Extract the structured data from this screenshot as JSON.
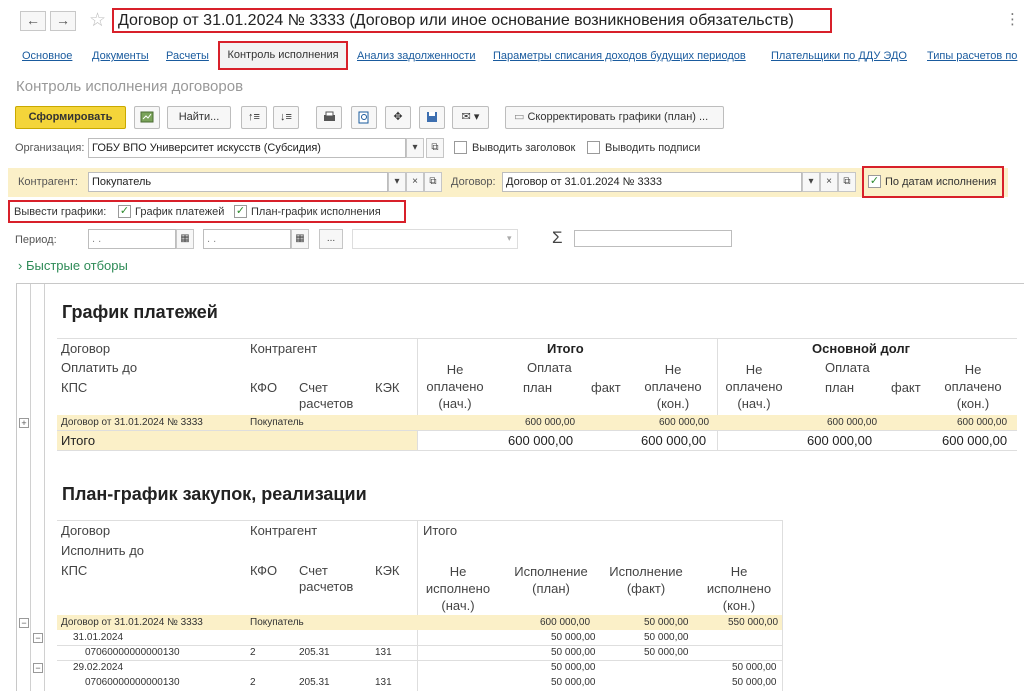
{
  "window": {
    "title": "Договор от 31.01.2024 № 3333 (Договор или иное основание возникновения обязательств)",
    "back_label": "←",
    "forward_label": "→",
    "more_label": "⋮"
  },
  "tabs": [
    "Основное",
    "Документы",
    "Расчеты",
    "Контроль исполнения",
    "Анализ задолженности",
    "Параметры списания доходов будущих периодов",
    "Плательщики по ДДУ ЭДО",
    "Типы расчетов по"
  ],
  "subtitle": "Контроль исполнения договоров",
  "toolbar": {
    "generate": "Сформировать",
    "find": "Найти...",
    "adjust": "Скорректировать графики (план) ..."
  },
  "filters": {
    "org_label": "Организация:",
    "org_value": "ГОБУ ВПО Университет искусств (Субсидия)",
    "show_header": "Выводить заголовок",
    "show_signatures": "Выводить подписи",
    "counterparty_label": "Контрагент:",
    "counterparty_value": "Покупатель",
    "contract_label": "Договор:",
    "contract_value": "Договор от 31.01.2024 № 3333",
    "by_dates": "По датам исполнения",
    "graphs_label": "Вывести графики:",
    "payments_graph": "График платежей",
    "plan_graph": "План-график исполнения",
    "period_label": "Период:",
    "date_placeholder": " .  .",
    "quick_filters": "Быстрые отборы"
  },
  "payments": {
    "title": "График платежей",
    "hdr": {
      "contract": "Договор",
      "pay_until": "Оплатить до",
      "kps": "КПС",
      "counterparty": "Контрагент",
      "kfo": "КФО",
      "account": "Счет расчетов",
      "kek": "КЭК",
      "total": "Итого",
      "principal": "Основной долг",
      "unpaid_start": "Не оплачено (нач.)",
      "payment": "Оплата",
      "plan": "план",
      "fact": "факт",
      "unpaid_end": "Не оплачено (кон.)"
    },
    "row": {
      "contract": "Договор от 31.01.2024 № 3333",
      "counterparty": "Покупатель",
      "plan": "600 000,00",
      "unpaid_end": "600 000,00",
      "plan2": "600 000,00",
      "unpaid_end2": "600 000,00"
    },
    "total": {
      "label": "Итого",
      "plan": "600 000,00",
      "unpaid_end": "600 000,00",
      "plan2": "600 000,00",
      "unpaid_end2": "600 000,00"
    }
  },
  "plan": {
    "title": "План-график закупок, реализации",
    "hdr": {
      "contract": "Договор",
      "execute_until": "Исполнить до",
      "kps": "КПС",
      "counterparty": "Контрагент",
      "kfo": "КФО",
      "account": "Счет расчетов",
      "kek": "КЭК",
      "total": "Итого",
      "not_exec_start": "Не исполнено (нач.)",
      "exec_plan": "Исполнение (план)",
      "exec_fact": "Исполнение (факт)",
      "not_exec_end": "Не исполнено (кон.)"
    },
    "rows": [
      {
        "name": "Договор от 31.01.2024 № 3333",
        "cp": "Покупатель",
        "kfo": "",
        "acc": "",
        "kek": "",
        "plan": "600 000,00",
        "fact": "50 000,00",
        "end": "550 000,00",
        "level": 0
      },
      {
        "name": "31.01.2024",
        "cp": "",
        "kfo": "",
        "acc": "",
        "kek": "",
        "plan": "50 000,00",
        "fact": "50 000,00",
        "end": "",
        "level": 1
      },
      {
        "name": "07060000000000130",
        "cp": "",
        "kfo": "2",
        "acc": "205.31",
        "kek": "131",
        "plan": "50 000,00",
        "fact": "50 000,00",
        "end": "",
        "level": 2
      },
      {
        "name": "29.02.2024",
        "cp": "",
        "kfo": "",
        "acc": "",
        "kek": "",
        "plan": "50 000,00",
        "fact": "",
        "end": "50 000,00",
        "level": 1
      },
      {
        "name": "07060000000000130",
        "cp": "",
        "kfo": "2",
        "acc": "205.31",
        "kek": "131",
        "plan": "50 000,00",
        "fact": "",
        "end": "50 000,00",
        "level": 2
      }
    ]
  }
}
